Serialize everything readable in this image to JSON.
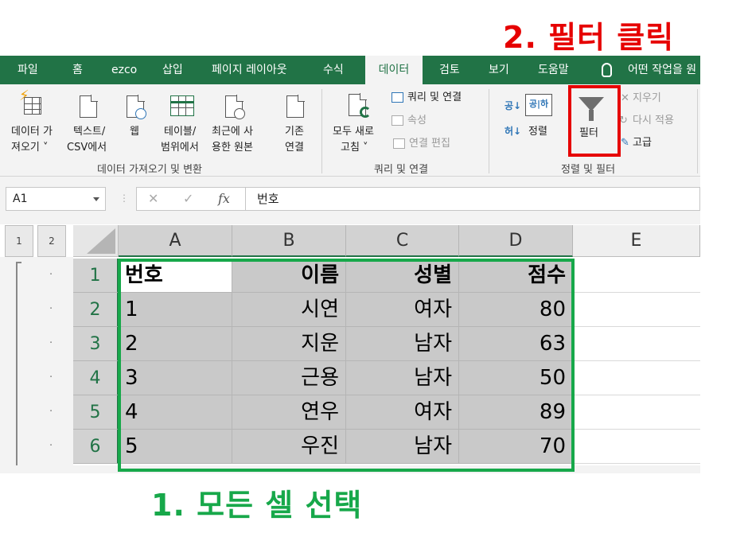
{
  "annotations": {
    "step2": "2. 필터 클릭",
    "step1": "1. 모든 셀 선택"
  },
  "tabs": [
    "파일",
    "홈",
    "ezco",
    "삽입",
    "페이지 레이아웃",
    "수식",
    "데이터",
    "검토",
    "보기",
    "도움말",
    "어떤 작업을 원"
  ],
  "active_tab": "데이터",
  "ribbon": {
    "get_data": [
      "데이터 가",
      "져오기 ˅"
    ],
    "from_text": [
      "텍스트/",
      "CSV에서"
    ],
    "web": "웹",
    "from_table": [
      "테이블/",
      "범위에서"
    ],
    "recent_sources": [
      "최근에 사",
      "용한 원본"
    ],
    "existing_connections": [
      "기존",
      "연결"
    ],
    "group_get_transform": "데이터 가져오기 및 변환",
    "refresh_all": [
      "모두 새로",
      "고침 ˅"
    ],
    "queries_connections": "쿼리 및 연결",
    "properties": "속성",
    "edit_links": "연결 편집",
    "group_queries": "쿼리 및 연결",
    "sort": "정렬",
    "sort_az": "공|하",
    "filter": "필터",
    "clear": "지우기",
    "reapply": "다시 적용",
    "advanced": "고급",
    "group_sort_filter": "정렬 및 필터"
  },
  "formula_bar": {
    "name_box": "A1",
    "content": "번호",
    "fx": "fx"
  },
  "outline_levels": [
    "1",
    "2"
  ],
  "columns": [
    "A",
    "B",
    "C",
    "D",
    "E"
  ],
  "rows": [
    {
      "num": "1",
      "cells": [
        "번호",
        "이름",
        "성별",
        "점수"
      ]
    },
    {
      "num": "2",
      "cells": [
        "1",
        "시연",
        "여자",
        "80"
      ]
    },
    {
      "num": "3",
      "cells": [
        "2",
        "지운",
        "남자",
        "63"
      ]
    },
    {
      "num": "4",
      "cells": [
        "3",
        "근용",
        "남자",
        "50"
      ]
    },
    {
      "num": "5",
      "cells": [
        "4",
        "연우",
        "여자",
        "89"
      ]
    },
    {
      "num": "6",
      "cells": [
        "5",
        "우진",
        "남자",
        "70"
      ]
    }
  ],
  "colors": {
    "excel_green": "#217346",
    "annotation_red": "#e60000",
    "annotation_green": "#17a84a",
    "selection_gray": "#c9c9c9"
  }
}
